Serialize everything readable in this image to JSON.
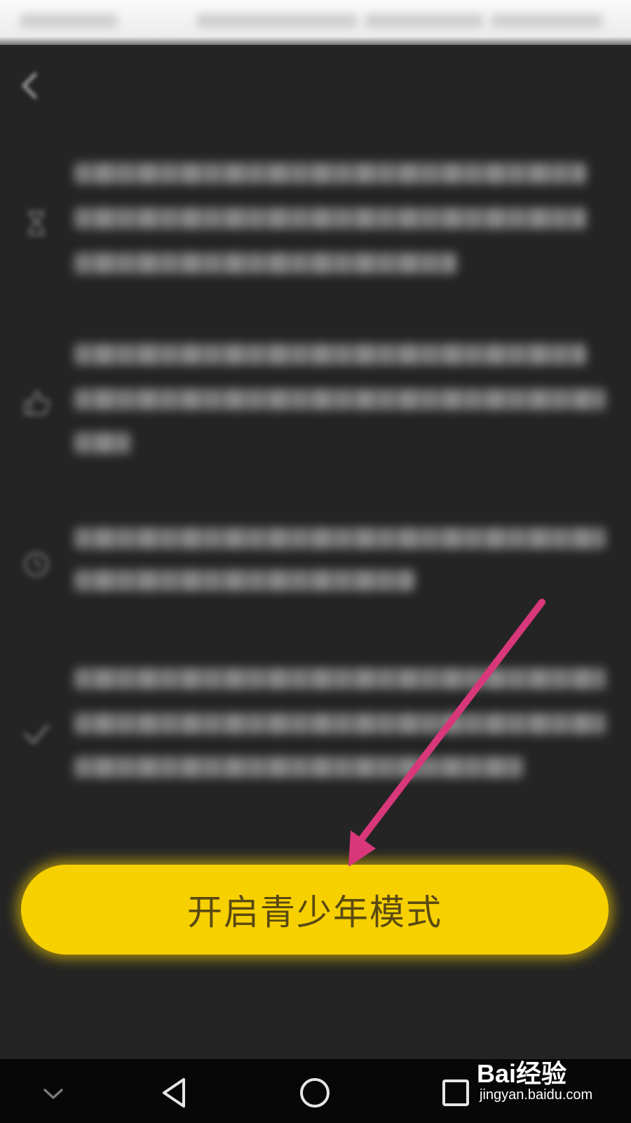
{
  "status_bar": {},
  "header": {
    "back_icon": "back-arrow-icon"
  },
  "info_items": [
    {
      "icon": "hourglass-icon"
    },
    {
      "icon": "thumbs-up-icon"
    },
    {
      "icon": "clock-icon"
    },
    {
      "icon": "check-icon"
    }
  ],
  "main": {
    "enable_button_label": "开启青少年模式"
  },
  "annotation": {
    "arrow_color": "#d8387a"
  },
  "nav_bar": {
    "collapse_icon": "chevron-down-icon",
    "back_icon": "triangle-back-icon",
    "home_icon": "circle-home-icon",
    "recents_icon": "square-recents-icon"
  },
  "watermark": {
    "brand": "Bai经验",
    "url": "jingyan.baidu.com"
  },
  "colors": {
    "background": "#242424",
    "button": "#f7d000",
    "button_text": "#5a4a12",
    "nav_bar": "#070707"
  }
}
